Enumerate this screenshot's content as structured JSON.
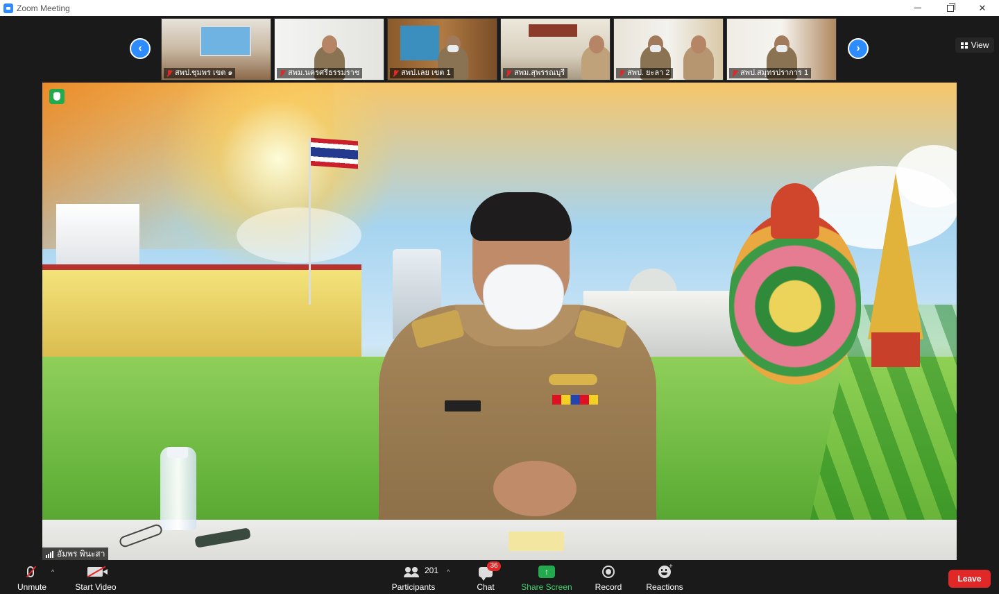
{
  "window": {
    "title": "Zoom Meeting"
  },
  "gallery": {
    "thumbnails": [
      {
        "name": "สพป.ชุมพร เขต ๑"
      },
      {
        "name": "สพม.นครศรีธรรมราช"
      },
      {
        "name": "สพป.เลย เขต 1"
      },
      {
        "name": "สพม.สุพรรณบุรี"
      },
      {
        "name": "สพป. ยะลา 2"
      },
      {
        "name": "สพป.สมุทรปราการ 1"
      }
    ],
    "view_label": "View",
    "prev_icon": "chevron-left-icon",
    "next_icon": "chevron-right-icon"
  },
  "main_video": {
    "speaker_name": "อัมพร พินะสา",
    "encryption_icon": "shield-icon"
  },
  "toolbar": {
    "unmute_label": "Unmute",
    "start_video_label": "Start Video",
    "participants_label": "Participants",
    "participants_count": "201",
    "chat_label": "Chat",
    "chat_badge": "36",
    "share_screen_label": "Share Screen",
    "record_label": "Record",
    "reactions_label": "Reactions",
    "leave_label": "Leave"
  },
  "colors": {
    "accent": "#2d8cff",
    "share_green": "#23a94e",
    "leave_red": "#e02828",
    "background": "#1a1a1a"
  }
}
